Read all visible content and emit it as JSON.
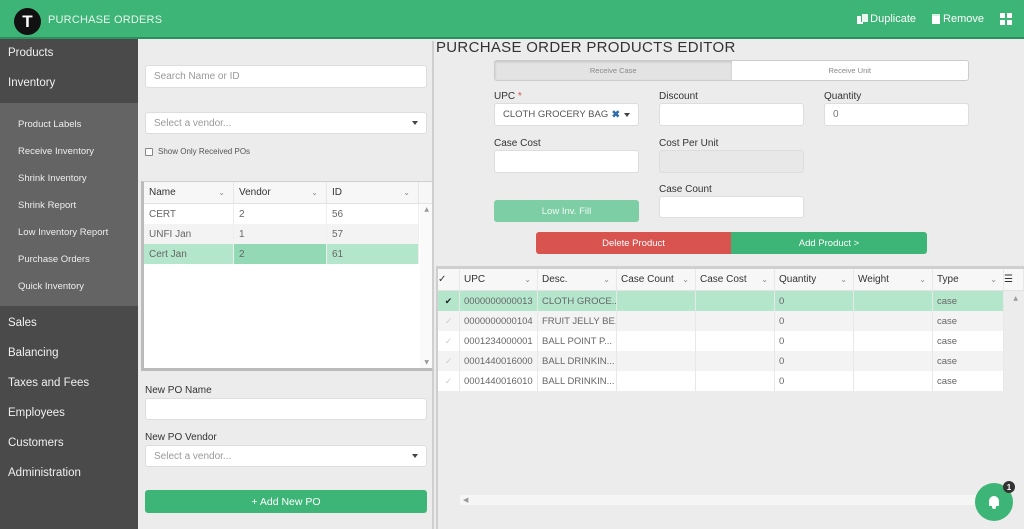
{
  "header": {
    "logo_letter": "T",
    "title": "PURCHASE ORDERS",
    "actions": [
      {
        "label": "Duplicate",
        "icon": "duplicate-icon"
      },
      {
        "label": "Remove",
        "icon": "trash-icon"
      }
    ],
    "grid_icon": "apps-grid-icon"
  },
  "sidebar": {
    "top_items": [
      {
        "label": "Products"
      },
      {
        "label": "Inventory"
      }
    ],
    "inventory_submenu": [
      {
        "label": "Product Labels"
      },
      {
        "label": "Receive Inventory"
      },
      {
        "label": "Shrink Inventory"
      },
      {
        "label": "Shrink Report"
      },
      {
        "label": "Low Inventory Report"
      },
      {
        "label": "Purchase Orders"
      },
      {
        "label": "Quick Inventory"
      }
    ],
    "bottom_items": [
      {
        "label": "Sales"
      },
      {
        "label": "Balancing"
      },
      {
        "label": "Taxes and Fees"
      },
      {
        "label": "Employees"
      },
      {
        "label": "Customers"
      },
      {
        "label": "Administration"
      }
    ]
  },
  "po_panel": {
    "search_placeholder": "Search Name or ID",
    "vendor_placeholder": "Select a vendor...",
    "show_received_label": "Show Only Received POs",
    "show_received_checked": false,
    "grid": {
      "columns": [
        "Name",
        "Vendor",
        "ID"
      ],
      "rows": [
        {
          "name": "CERT",
          "vendor": "2",
          "id": "56",
          "selected": false
        },
        {
          "name": "UNFI Jan",
          "vendor": "1",
          "id": "57",
          "selected": false
        },
        {
          "name": "Cert Jan",
          "vendor": "2",
          "id": "61",
          "selected": true
        }
      ]
    },
    "new_po_name_label": "New PO Name",
    "new_po_name_value": "",
    "new_po_vendor_label": "New PO Vendor",
    "new_po_vendor_placeholder": "Select a vendor...",
    "add_button": "+ Add New PO"
  },
  "editor": {
    "title": "PURCHASE ORDER PRODUCTS EDITOR",
    "modes": [
      {
        "label": "Receive Case",
        "active": true
      },
      {
        "label": "Receive Unit",
        "active": false
      }
    ],
    "upc_label": "UPC",
    "upc_required_mark": "*",
    "upc_value": "CLOTH GROCERY BAG",
    "discount_label": "Discount",
    "discount_value": "",
    "quantity_label": "Quantity",
    "quantity_value": "0",
    "case_cost_label": "Case Cost",
    "case_cost_value": "",
    "cost_per_unit_label": "Cost Per Unit",
    "cost_per_unit_value": "",
    "case_count_label": "Case Count",
    "case_count_value": "",
    "low_inv_button": "Low Inv. Fill",
    "delete_button": "Delete Product",
    "add_button": "Add Product >"
  },
  "products_grid": {
    "columns": [
      "UPC",
      "Desc.",
      "Case Count",
      "Case Cost",
      "Quantity",
      "Weight",
      "Type"
    ],
    "rows": [
      {
        "upc": "0000000000013",
        "desc": "CLOTH GROCE...",
        "case_count": "",
        "case_cost": "",
        "quantity": "0",
        "weight": "",
        "type": "case",
        "selected": true
      },
      {
        "upc": "0000000000104",
        "desc": "FRUIT JELLY BE...",
        "case_count": "",
        "case_cost": "",
        "quantity": "0",
        "weight": "",
        "type": "case",
        "selected": false
      },
      {
        "upc": "0001234000001",
        "desc": "BALL POINT P...",
        "case_count": "",
        "case_cost": "",
        "quantity": "0",
        "weight": "",
        "type": "case",
        "selected": false
      },
      {
        "upc": "0001440016000",
        "desc": "BALL DRINKIN...",
        "case_count": "",
        "case_cost": "",
        "quantity": "0",
        "weight": "",
        "type": "case",
        "selected": false
      },
      {
        "upc": "0001440016010",
        "desc": "BALL DRINKIN...",
        "case_count": "",
        "case_cost": "",
        "quantity": "0",
        "weight": "",
        "type": "case",
        "selected": false
      }
    ]
  },
  "notifications": {
    "count": "1",
    "icon": "bell-icon"
  },
  "colors": {
    "brand_green": "#3db577",
    "danger_red": "#d9534f",
    "selected_row": "#b4e6cc",
    "sidebar_bg": "#4a4a4b",
    "submenu_bg": "#646465"
  }
}
